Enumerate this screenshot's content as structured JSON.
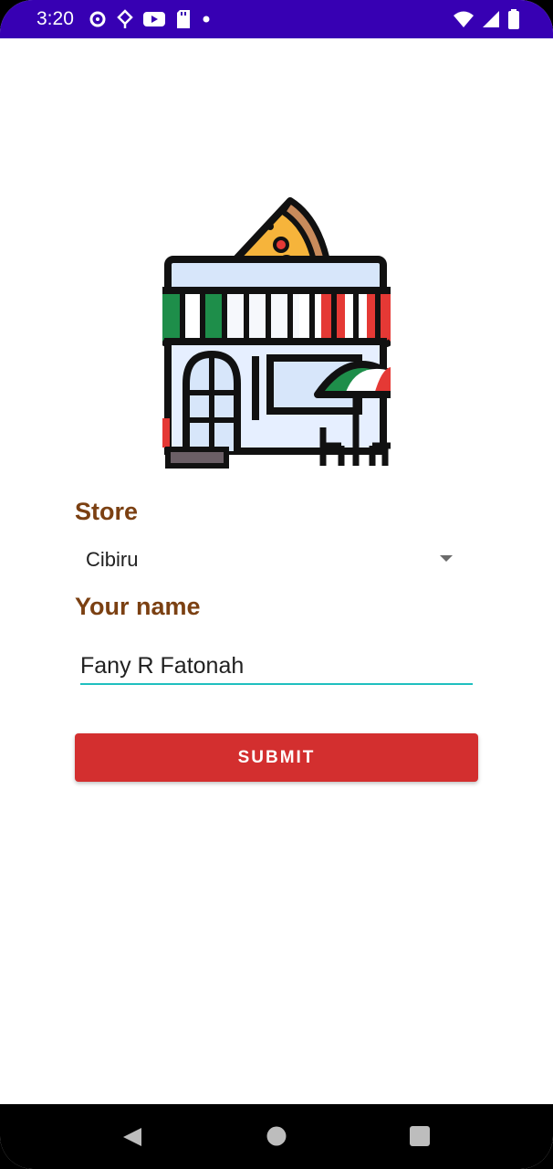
{
  "status_bar": {
    "time": "3:20",
    "icons_left": [
      "sync-icon",
      "data-saver-icon",
      "youtube-icon",
      "sd-card-icon",
      "dot-icon"
    ],
    "icons_right": [
      "wifi-icon",
      "signal-icon",
      "battery-icon"
    ]
  },
  "store_logo": {
    "icon": "pizza-store-icon"
  },
  "form": {
    "store_label": "Store",
    "store_selected": "Cibiru",
    "name_label": "Your name",
    "name_value": "Fany R Fatonah",
    "submit_label": "SUBMIT"
  },
  "nav_bar": {
    "icons": [
      "back-icon",
      "home-icon",
      "recents-icon"
    ]
  },
  "colors": {
    "status_bar": "#3700b3",
    "label": "#7b4012",
    "accent_underline": "#1fbfbf",
    "submit": "#d32f2f"
  }
}
